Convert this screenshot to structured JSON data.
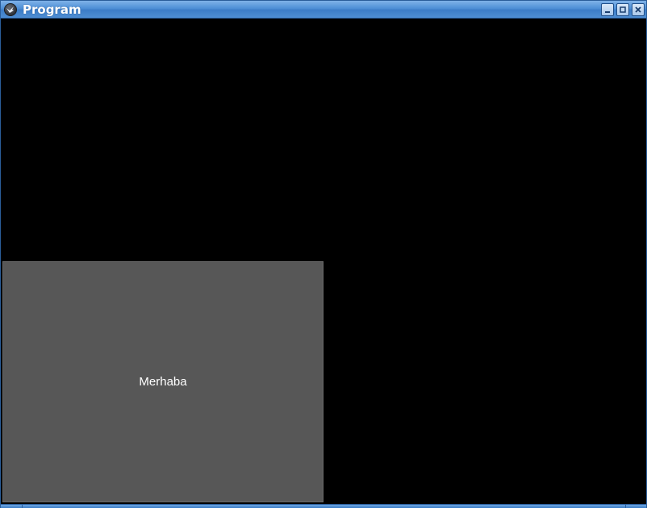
{
  "window": {
    "title": "Program",
    "icon": "app-bird-icon",
    "controls": {
      "minimize": "minimize-icon",
      "maximize": "maximize-icon",
      "close": "close-icon"
    }
  },
  "content": {
    "panel_label": "Merhaba"
  },
  "colors": {
    "titlebar": "#4e8fd6",
    "background": "#000000",
    "panel": "#575757",
    "text": "#ffffff"
  }
}
